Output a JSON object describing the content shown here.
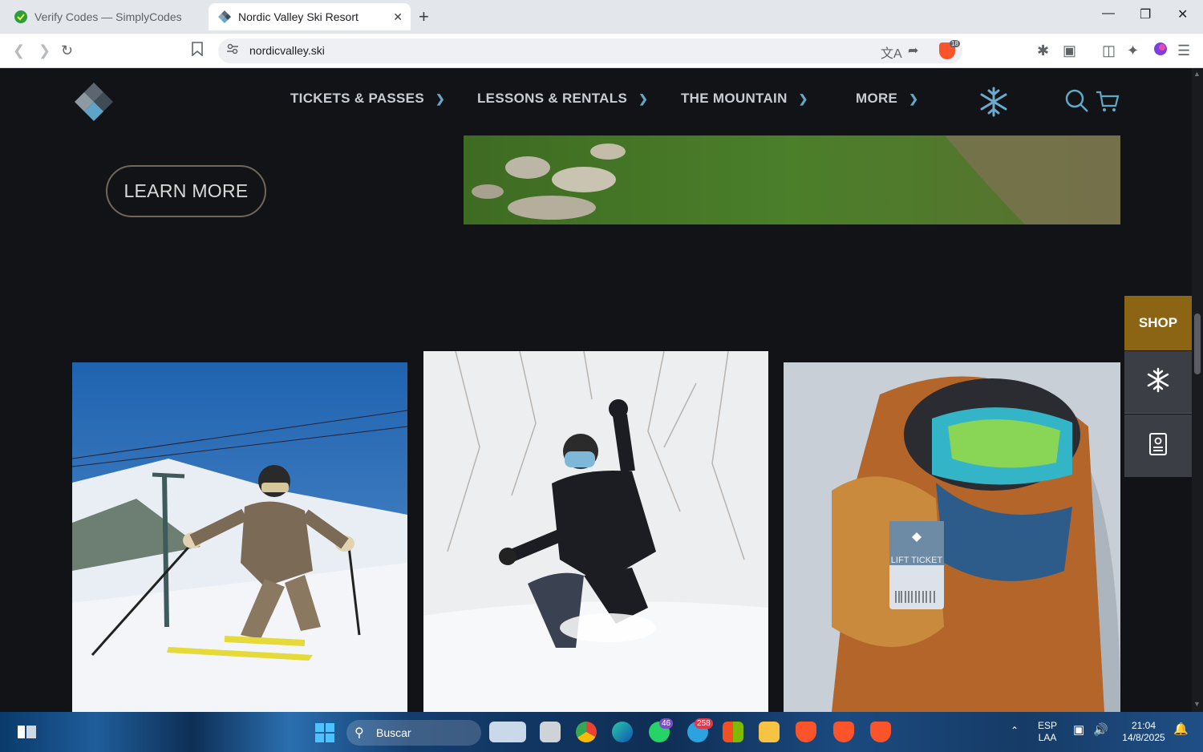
{
  "browser": {
    "tabs": [
      {
        "title": "Verify Codes — SimplyCodes",
        "active": false
      },
      {
        "title": "Nordic Valley Ski Resort",
        "active": true
      }
    ],
    "url": "nordicvalley.ski",
    "shield_count": "18"
  },
  "site": {
    "nav": [
      {
        "label": "TICKETS & PASSES"
      },
      {
        "label": "LESSONS & RENTALS"
      },
      {
        "label": "THE MOUNTAIN"
      },
      {
        "label": "MORE"
      }
    ],
    "learn_more_label": "LEARN MORE",
    "photos": [
      {
        "subject": "skier-on-groomed-slope"
      },
      {
        "subject": "snowboarder-in-powder"
      },
      {
        "subject": "rider-holding-lift-ticket",
        "overlay_text": "LIFT TICKET"
      }
    ],
    "side_widget": {
      "shop_label": "SHOP"
    }
  },
  "taskbar": {
    "search_placeholder": "Buscar",
    "whatsapp_badge": "46",
    "telegram_badge": "258",
    "language": "ESP",
    "layout": "LAA",
    "time": "21:04",
    "date": "14/8/2025"
  },
  "colors": {
    "page_bg": "#121317",
    "nav_text": "#c7cdd2",
    "nav_chevron": "#63a7c6",
    "shop_gold": "#8b6414",
    "side_gray": "#3b3f45"
  }
}
